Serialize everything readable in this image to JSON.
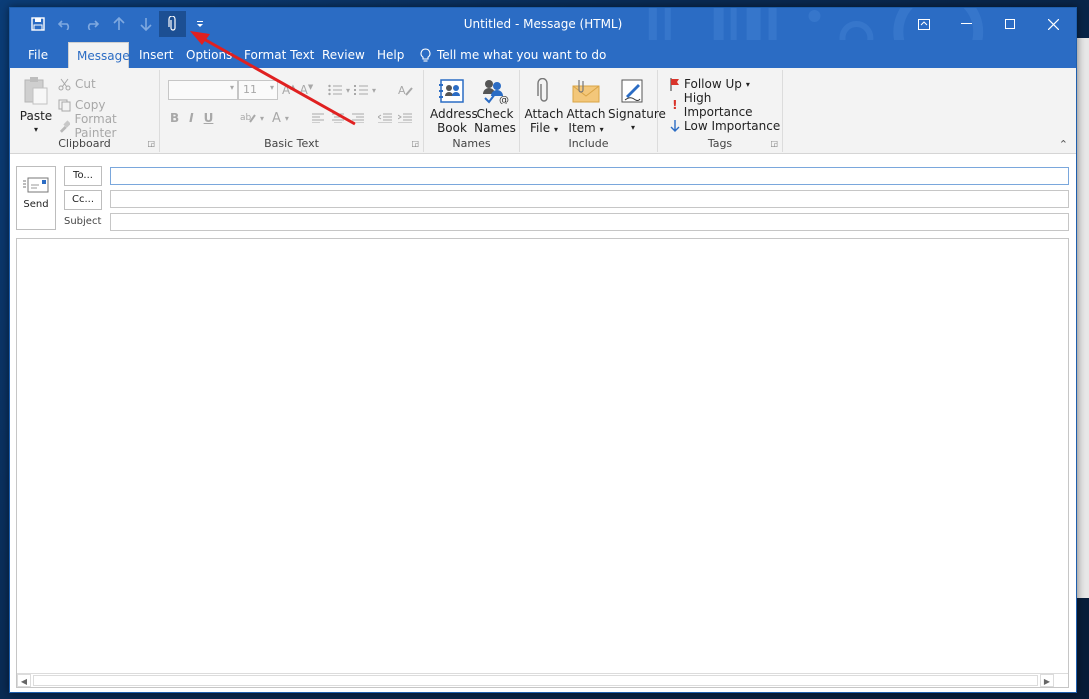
{
  "window": {
    "title": "Untitled  -  Message (HTML)"
  },
  "quick_access": {
    "icons": [
      "save-icon",
      "undo-icon",
      "redo-icon",
      "up-arrow-icon",
      "down-arrow-icon",
      "attach-icon",
      "customize-icon"
    ]
  },
  "tabs": [
    {
      "label": "File"
    },
    {
      "label": "Message",
      "active": true
    },
    {
      "label": "Insert"
    },
    {
      "label": "Options"
    },
    {
      "label": "Format Text"
    },
    {
      "label": "Review"
    },
    {
      "label": "Help"
    }
  ],
  "tell_me": "Tell me what you want to do",
  "ribbon": {
    "clipboard": {
      "label": "Clipboard",
      "paste": "Paste",
      "cut": "Cut",
      "copy": "Copy",
      "format_painter": "Format Painter"
    },
    "basic_text": {
      "label": "Basic Text",
      "font_name": "",
      "font_size": "11",
      "bold": "B",
      "italic": "I",
      "underline": "U"
    },
    "names": {
      "label": "Names",
      "address_book_line1": "Address",
      "address_book_line2": "Book",
      "check_names_line1": "Check",
      "check_names_line2": "Names"
    },
    "include": {
      "label": "Include",
      "attach_file_line1": "Attach",
      "attach_file_line2": "File",
      "attach_item_line1": "Attach",
      "attach_item_line2": "Item",
      "signature": "Signature"
    },
    "tags": {
      "label": "Tags",
      "follow_up": "Follow Up",
      "high_importance": "High Importance",
      "low_importance": "Low Importance"
    }
  },
  "compose": {
    "send": "Send",
    "to": "To...",
    "cc": "Cc...",
    "subject": "Subject",
    "to_value": "",
    "cc_value": "",
    "subject_value": ""
  },
  "colors": {
    "title_bar": "#2b6cc4",
    "annotation_arrow": "#e02020"
  }
}
